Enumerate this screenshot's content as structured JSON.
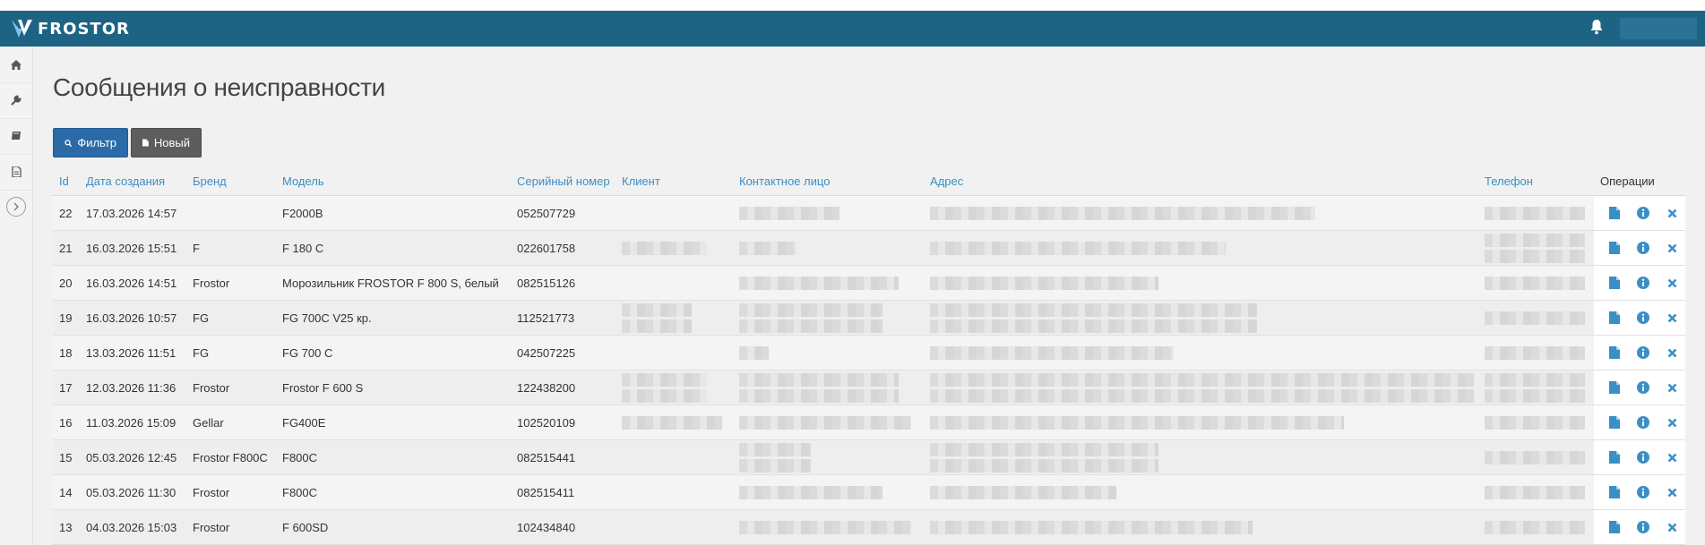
{
  "app": {
    "logo_text": "FROSTOR",
    "accent": "#1d6384",
    "link_color": "#3a8fc6"
  },
  "page": {
    "title": "Сообщения о неисправности"
  },
  "toolbar": {
    "filter_label": "Фильтр",
    "new_label": "Новый"
  },
  "sidebar": {
    "items": [
      {
        "name": "home-icon"
      },
      {
        "name": "wrench-icon"
      },
      {
        "name": "book-icon"
      },
      {
        "name": "document-icon"
      }
    ],
    "toggle_icon": "chevron-right-icon"
  },
  "table": {
    "columns": [
      "Id",
      "Дата создания",
      "Бренд",
      "Модель",
      "Серийный номер",
      "Клиент",
      "Контактное лицо",
      "Адрес",
      "Телефон",
      "Операции"
    ],
    "rows": [
      {
        "id": "22",
        "date": "17.03.2026 14:57",
        "brand": "",
        "model": "F2000B",
        "serial": "052507729"
      },
      {
        "id": "21",
        "date": "16.03.2026 15:51",
        "brand": "F",
        "model": "F 180 C",
        "serial": "022601758"
      },
      {
        "id": "20",
        "date": "16.03.2026 14:51",
        "brand": "Frostor",
        "model": "Морозильник FROSTOR F 800 S, белый",
        "serial": "082515126"
      },
      {
        "id": "19",
        "date": "16.03.2026 10:57",
        "brand": "FG",
        "model": "FG 700C V25 кр.",
        "serial": "112521773"
      },
      {
        "id": "18",
        "date": "13.03.2026 11:51",
        "brand": "FG",
        "model": "FG 700 C",
        "serial": "042507225"
      },
      {
        "id": "17",
        "date": "12.03.2026 11:36",
        "brand": "Frostor",
        "model": "Frostor F 600 S",
        "serial": "122438200"
      },
      {
        "id": "16",
        "date": "11.03.2026 15:09",
        "brand": "Gellar",
        "model": "FG400E",
        "serial": "102520109"
      },
      {
        "id": "15",
        "date": "05.03.2026 12:45",
        "brand": "Frostor F800C",
        "model": "F800C",
        "serial": "082515441"
      },
      {
        "id": "14",
        "date": "05.03.2026 11:30",
        "brand": "Frostor",
        "model": "F800C",
        "serial": "082515411"
      },
      {
        "id": "13",
        "date": "04.03.2026 15:03",
        "brand": "Frostor",
        "model": "F 600SD",
        "serial": "102434840"
      }
    ],
    "ops_icons": [
      "document-icon",
      "info-icon",
      "delete-icon"
    ]
  },
  "header": {
    "bell_icon": "bell-icon"
  }
}
